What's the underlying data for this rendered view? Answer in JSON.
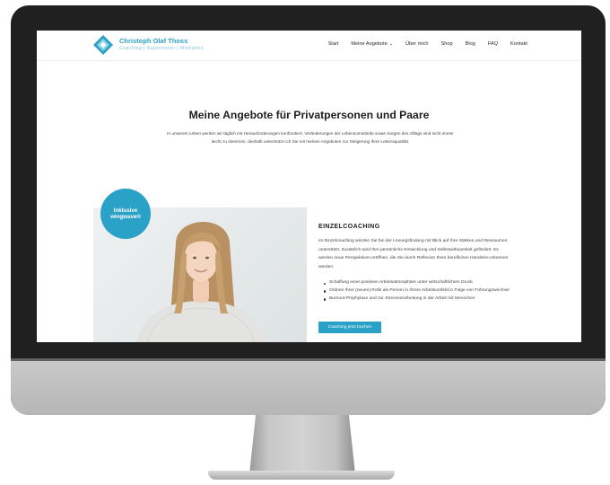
{
  "site": {
    "brand_name": "Christoph Olaf Thoss",
    "brand_tagline": "Coaching | Supervision | Mediation"
  },
  "nav": [
    {
      "label": "Start"
    },
    {
      "label": "Meine Angebote",
      "icon": "chevron-down-icon"
    },
    {
      "label": "Über mich"
    },
    {
      "label": "Shop"
    },
    {
      "label": "Blog"
    },
    {
      "label": "FAQ"
    },
    {
      "label": "Kontakt"
    }
  ],
  "hero": {
    "title": "Meine Angebote für Privatpersonen und Paare",
    "intro": "In unserem Leben werden wir täglich mit Herausforderungen konfrontiert. Veränderungen der Lebensumstände sowie Sorgen des Alltags sind nicht immer leicht zu stemmen, deshalb unterstütze ich Sie mit meinen Angeboten zur Steigerung Ihrer Lebensqualität."
  },
  "offer": {
    "badge_line1": "Inklusive",
    "badge_line2": "wingwave®",
    "title": "EINZELCOACHING",
    "text": "Im Einzelcoaching werden Sie bei der Lösungsfindung mit Blick auf Ihre Stärken und Ressourcen unterstützt. Zusätzlich wird Ihre persönliche Entwicklung und Selbstwirksamkeit gefördert. Es werden neue Perspektiven eröffnen, die Sie durch Reflexion Ihres beruflichen Handelns erkennen werden.",
    "bullets": [
      "Schaffung einer positiven Arbeitsatmosphäre unter wirtschaftlichem Druck",
      "Ordnen Ihrer (neuen) Rolle als Person in Ihrem Arbeitsumfeld in Folge von Führungswechsel",
      "Burnout-Prophylaxe und zur Stressverarbeitung in der Arbeit mit Menschen"
    ],
    "cta_label": "Coaching jetzt buchen"
  },
  "colors": {
    "accent": "#2aa1c6",
    "monitor_bezel": "#202020",
    "monitor_chin": "#c2c2c2"
  }
}
